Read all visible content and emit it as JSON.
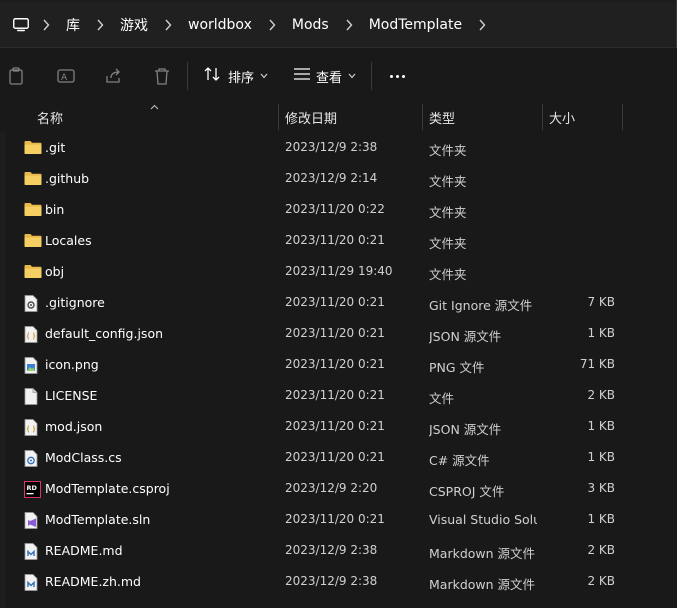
{
  "breadcrumb": {
    "items": [
      "库",
      "游戏",
      "worldbox",
      "Mods",
      "ModTemplate"
    ]
  },
  "toolbar": {
    "sort_label": "排序",
    "view_label": "查看"
  },
  "columns": {
    "name": "名称",
    "date": "修改日期",
    "type": "类型",
    "size": "大小"
  },
  "files": [
    {
      "name": ".git",
      "date": "2023/12/9 2:38",
      "type": "文件夹",
      "size": "",
      "icon": "folder-icon"
    },
    {
      "name": ".github",
      "date": "2023/12/9 2:14",
      "type": "文件夹",
      "size": "",
      "icon": "folder-icon"
    },
    {
      "name": "bin",
      "date": "2023/11/20 0:22",
      "type": "文件夹",
      "size": "",
      "icon": "folder-icon"
    },
    {
      "name": "Locales",
      "date": "2023/11/20 0:21",
      "type": "文件夹",
      "size": "",
      "icon": "folder-icon"
    },
    {
      "name": "obj",
      "date": "2023/11/29 19:40",
      "type": "文件夹",
      "size": "",
      "icon": "folder-icon"
    },
    {
      "name": ".gitignore",
      "date": "2023/11/20 0:21",
      "type": "Git Ignore 源文件",
      "size": "7 KB",
      "icon": "gear-file-icon"
    },
    {
      "name": "default_config.json",
      "date": "2023/11/20 0:21",
      "type": "JSON 源文件",
      "size": "1 KB",
      "icon": "json-file-icon"
    },
    {
      "name": "icon.png",
      "date": "2023/11/20 0:21",
      "type": "PNG 文件",
      "size": "71 KB",
      "icon": "image-file-icon"
    },
    {
      "name": "LICENSE",
      "date": "2023/11/20 0:21",
      "type": "文件",
      "size": "2 KB",
      "icon": "blank-file-icon"
    },
    {
      "name": "mod.json",
      "date": "2023/11/20 0:21",
      "type": "JSON 源文件",
      "size": "1 KB",
      "icon": "json-file-icon"
    },
    {
      "name": "ModClass.cs",
      "date": "2023/11/20 0:21",
      "type": "C# 源文件",
      "size": "1 KB",
      "icon": "csharp-file-icon"
    },
    {
      "name": "ModTemplate.csproj",
      "date": "2023/12/9 2:20",
      "type": "CSPROJ 文件",
      "size": "3 KB",
      "icon": "rider-file-icon"
    },
    {
      "name": "ModTemplate.sln",
      "date": "2023/11/20 0:21",
      "type": "Visual Studio Solu...",
      "size": "1 KB",
      "icon": "sln-file-icon"
    },
    {
      "name": "README.md",
      "date": "2023/12/9 2:38",
      "type": "Markdown 源文件",
      "size": "2 KB",
      "icon": "markdown-file-icon"
    },
    {
      "name": "README.zh.md",
      "date": "2023/12/9 2:38",
      "type": "Markdown 源文件",
      "size": "2 KB",
      "icon": "markdown-file-icon"
    }
  ]
}
